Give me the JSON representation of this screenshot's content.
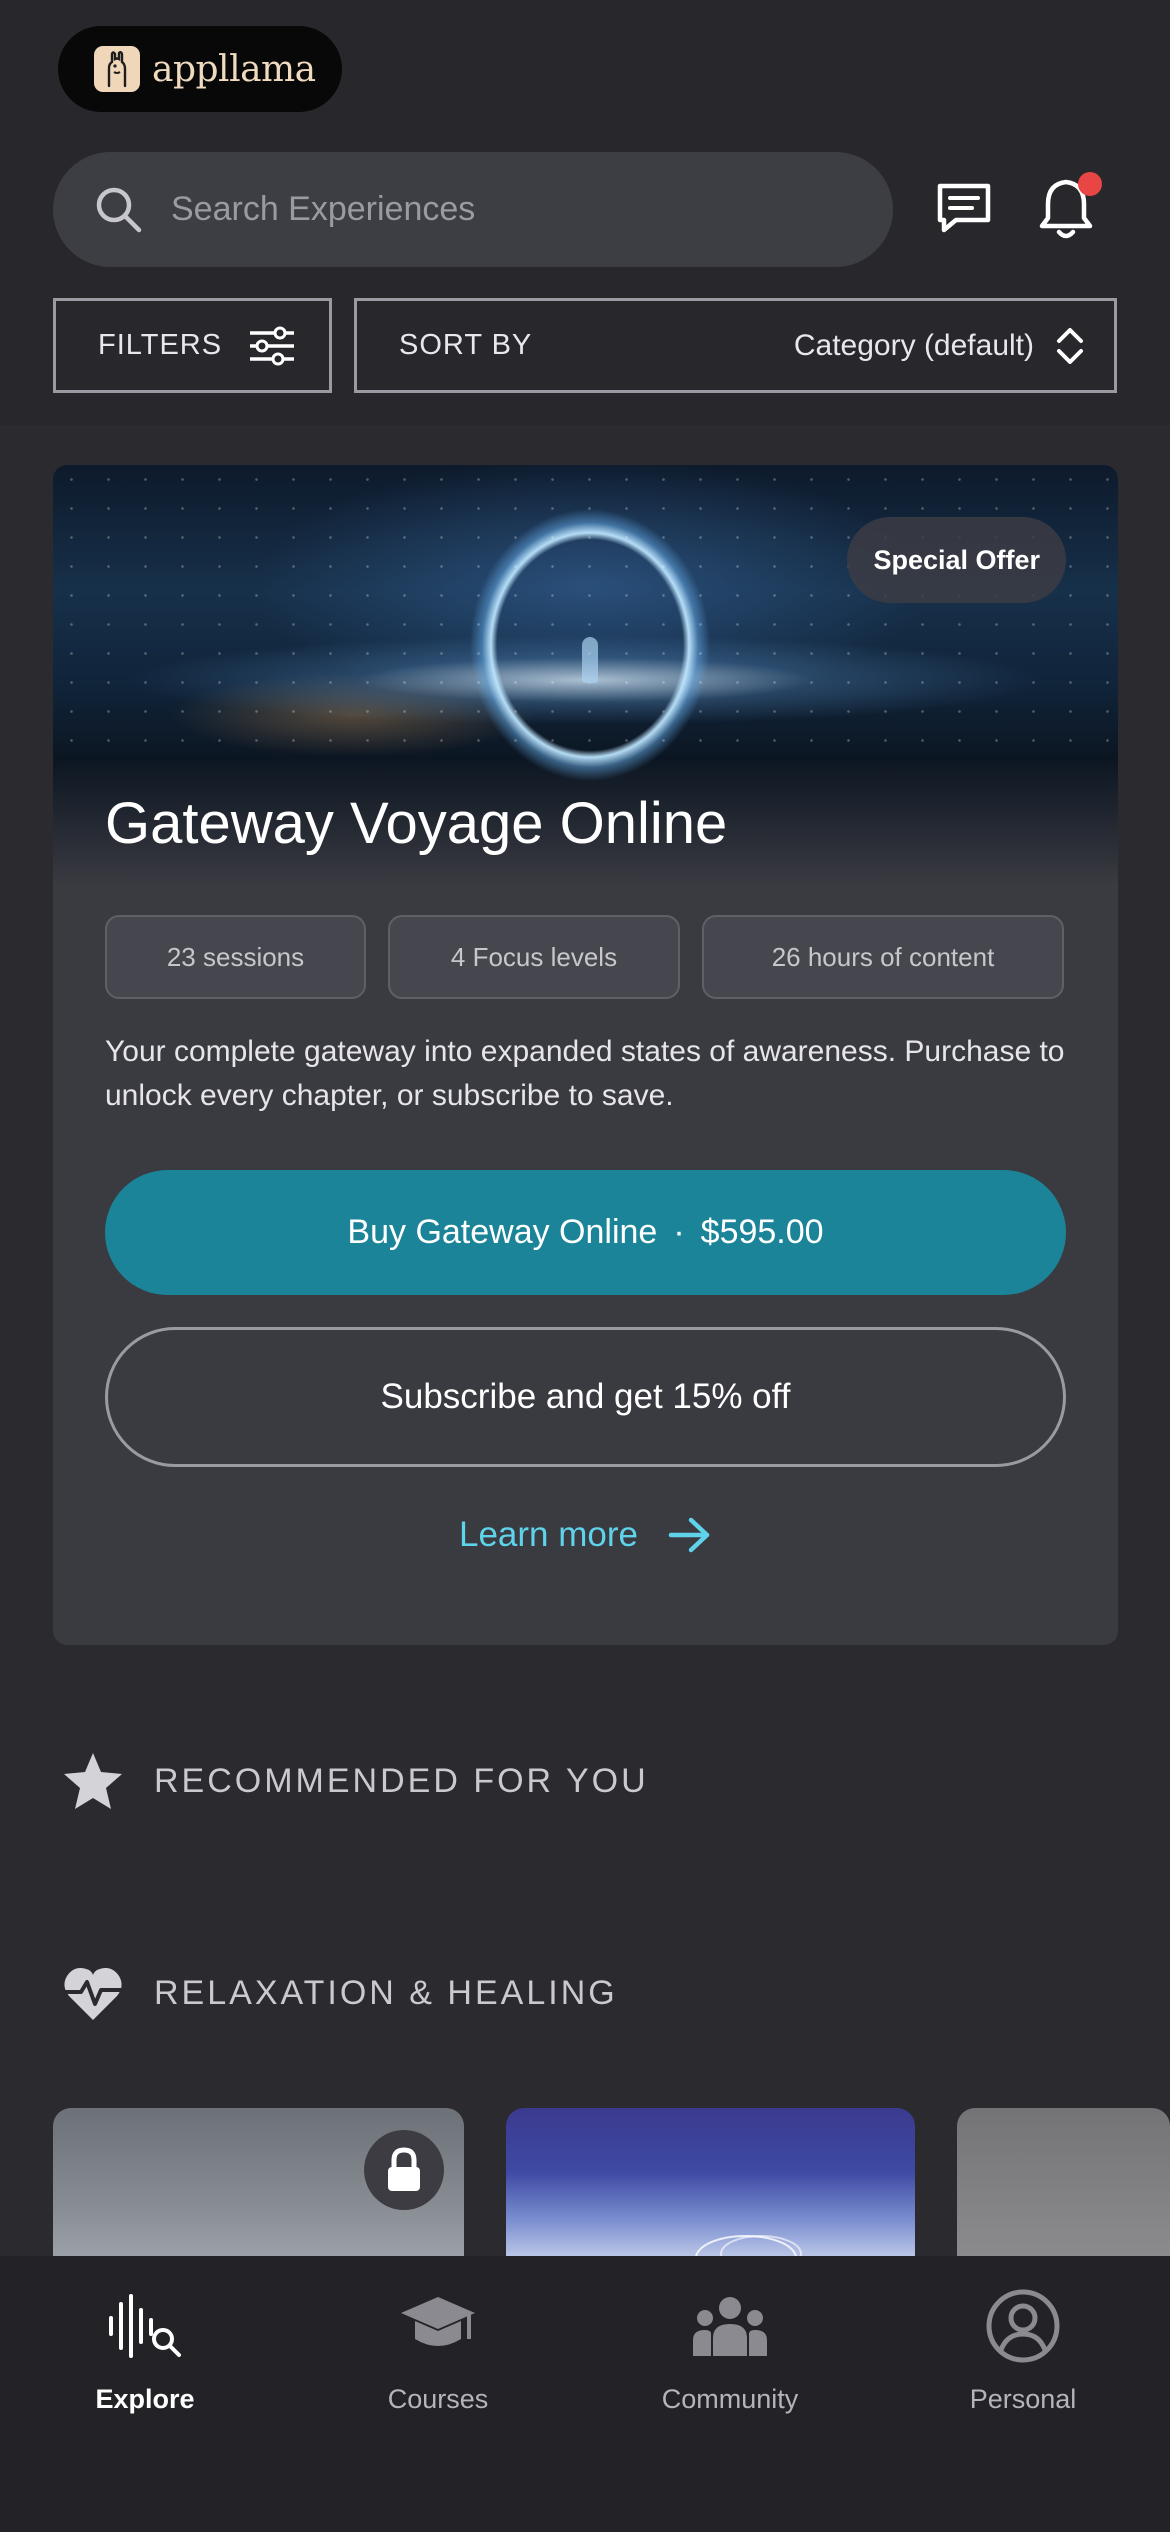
{
  "app": {
    "name": "appllama"
  },
  "search": {
    "placeholder": "Search Experiences"
  },
  "toolbar": {
    "filters_label": "FILTERS",
    "sort_label": "SORT BY",
    "sort_value": "Category (default)"
  },
  "featured": {
    "badge": "Special Offer",
    "title": "Gateway Voyage Online",
    "tags": [
      "23 sessions",
      "4 Focus levels",
      "26 hours of content"
    ],
    "description": "Your complete gateway into expanded states of awareness. Purchase to unlock every chapter, or subscribe to save.",
    "buy_label": "Buy Gateway Online",
    "buy_separator": "·",
    "buy_price": "$595.00",
    "subscribe_label": "Subscribe and get 15% off",
    "learn_more_label": "Learn more"
  },
  "sections": [
    {
      "title": "RECOMMENDED FOR YOU",
      "icon": "star-icon"
    },
    {
      "title": "RELAXATION & HEALING",
      "icon": "heart-pulse-icon"
    }
  ],
  "tabs": [
    {
      "label": "Explore",
      "icon": "explore-waveform-icon",
      "active": true
    },
    {
      "label": "Courses",
      "icon": "graduation-cap-icon",
      "active": false
    },
    {
      "label": "Community",
      "icon": "community-people-icon",
      "active": false
    },
    {
      "label": "Personal",
      "icon": "user-circle-icon",
      "active": false
    }
  ],
  "colors": {
    "background": "#2a2a2f",
    "card": "#3a3a41",
    "accent_button": "#1b8499",
    "link": "#5fd3ea",
    "notification_dot": "#e84545"
  }
}
